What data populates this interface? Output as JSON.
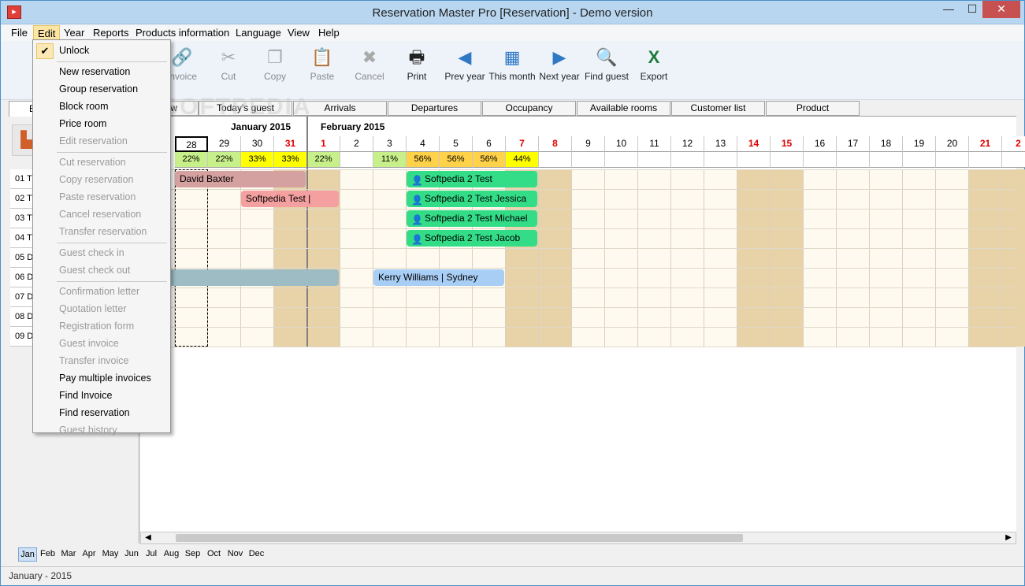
{
  "window": {
    "title": "Reservation Master Pro [Reservation] - Demo version",
    "minimize": "—",
    "maximize": "☐",
    "close": "✕"
  },
  "menubar": [
    "File",
    "Edit",
    "Year",
    "Reports",
    "Products information",
    "Language",
    "View",
    "Help"
  ],
  "toolbar": [
    {
      "label": "Invoice",
      "icon": "invoice-icon",
      "glyph": "🔗",
      "disabled": true
    },
    {
      "label": "Cut",
      "icon": "scissors-icon",
      "glyph": "✂",
      "disabled": true
    },
    {
      "label": "Copy",
      "icon": "copy-icon",
      "glyph": "❐",
      "disabled": true
    },
    {
      "label": "Paste",
      "icon": "paste-icon",
      "glyph": "📋",
      "disabled": true
    },
    {
      "label": "Cancel",
      "icon": "cancel-icon",
      "glyph": "✖",
      "disabled": true
    },
    {
      "label": "Print",
      "icon": "printer-icon",
      "glyph": "🖶",
      "disabled": false
    },
    {
      "label": "Prev year",
      "icon": "prev-year-icon",
      "glyph": "◀",
      "disabled": false
    },
    {
      "label": "This month",
      "icon": "this-month-icon",
      "glyph": "▦",
      "disabled": false
    },
    {
      "label": "Next year",
      "icon": "next-year-icon",
      "glyph": "▶",
      "disabled": false
    },
    {
      "label": "Find guest",
      "icon": "find-guest-icon",
      "glyph": "🔍",
      "disabled": false
    },
    {
      "label": "Export",
      "icon": "excel-export-icon",
      "glyph": "X",
      "disabled": false
    }
  ],
  "tabs": [
    "w",
    "Today's guest",
    "Arrivals",
    "Departures",
    "Occupancy",
    "Available rooms",
    "Customer list",
    "Product"
  ],
  "left_panel": {
    "tab": "B",
    "rooms": [
      "01 T",
      "02 T",
      "03 T",
      "04 T",
      "05 D",
      "06 D",
      "07 D",
      "08 D",
      "09 D"
    ]
  },
  "calendar": {
    "months": [
      "January 2015",
      "February 2015"
    ],
    "days": [
      {
        "d": "28",
        "occ": "22%",
        "red": false
      },
      {
        "d": "29",
        "occ": "22%",
        "red": false
      },
      {
        "d": "30",
        "occ": "33%",
        "red": false
      },
      {
        "d": "31",
        "occ": "33%",
        "red": true
      },
      {
        "d": "1",
        "occ": "22%",
        "red": true
      },
      {
        "d": "2",
        "occ": "",
        "red": false
      },
      {
        "d": "3",
        "occ": "11%",
        "red": false
      },
      {
        "d": "4",
        "occ": "56%",
        "red": false
      },
      {
        "d": "5",
        "occ": "56%",
        "red": false
      },
      {
        "d": "6",
        "occ": "56%",
        "red": false
      },
      {
        "d": "7",
        "occ": "44%",
        "red": true
      },
      {
        "d": "8",
        "occ": "",
        "red": true
      },
      {
        "d": "9",
        "occ": "",
        "red": false
      },
      {
        "d": "10",
        "occ": "",
        "red": false
      },
      {
        "d": "11",
        "occ": "",
        "red": false
      },
      {
        "d": "12",
        "occ": "",
        "red": false
      },
      {
        "d": "13",
        "occ": "",
        "red": false
      },
      {
        "d": "14",
        "occ": "",
        "red": true
      },
      {
        "d": "15",
        "occ": "",
        "red": true
      },
      {
        "d": "16",
        "occ": "",
        "red": false
      },
      {
        "d": "17",
        "occ": "",
        "red": false
      },
      {
        "d": "18",
        "occ": "",
        "red": false
      },
      {
        "d": "19",
        "occ": "",
        "red": false
      },
      {
        "d": "20",
        "occ": "",
        "red": false
      },
      {
        "d": "21",
        "occ": "",
        "red": true
      },
      {
        "d": "2",
        "occ": "",
        "red": true
      }
    ],
    "reservations": [
      {
        "label": "David Baxter",
        "row": 0,
        "start": 0,
        "span": 4,
        "color": "#d4a0a0",
        "icon": false
      },
      {
        "label": "Softpedia 2 Test",
        "row": 0,
        "start": 7,
        "span": 4,
        "color": "#33dd88",
        "icon": true
      },
      {
        "label": "Softpedia Test |",
        "row": 1,
        "start": 2,
        "span": 3,
        "color": "#f4a0a0",
        "icon": false
      },
      {
        "label": "Softpedia 2 Test Jessica",
        "row": 1,
        "start": 7,
        "span": 4,
        "color": "#33dd88",
        "icon": true
      },
      {
        "label": "Softpedia 2 Test Michael",
        "row": 2,
        "start": 7,
        "span": 4,
        "color": "#33dd88",
        "icon": true
      },
      {
        "label": "Softpedia 2 Test Jacob",
        "row": 3,
        "start": 7,
        "span": 4,
        "color": "#33dd88",
        "icon": true
      },
      {
        "label": "",
        "row": 5,
        "start": -1,
        "span": 6,
        "color": "#9dbcc4",
        "icon": false
      },
      {
        "label": "Kerry Williams | Sydney",
        "row": 5,
        "start": 6,
        "span": 4,
        "color": "#a8cef5",
        "icon": false
      }
    ]
  },
  "months_bar": [
    "Jan",
    "Feb",
    "Mar",
    "Apr",
    "May",
    "Jun",
    "Jul",
    "Aug",
    "Sep",
    "Oct",
    "Nov",
    "Dec"
  ],
  "status": "January - 2015",
  "edit_menu": [
    {
      "label": "Unlock",
      "disabled": false,
      "checked": true
    },
    {
      "sep": true
    },
    {
      "label": "New reservation",
      "disabled": false
    },
    {
      "label": "Group reservation",
      "disabled": false
    },
    {
      "label": "Block room",
      "disabled": false
    },
    {
      "label": "Price room",
      "disabled": false
    },
    {
      "label": "Edit reservation",
      "disabled": true
    },
    {
      "sep": true
    },
    {
      "label": "Cut reservation",
      "disabled": true
    },
    {
      "label": "Copy reservation",
      "disabled": true
    },
    {
      "label": "Paste reservation",
      "disabled": true
    },
    {
      "label": "Cancel reservation",
      "disabled": true
    },
    {
      "label": "Transfer reservation",
      "disabled": true
    },
    {
      "sep": true
    },
    {
      "label": "Guest check in",
      "disabled": true
    },
    {
      "label": "Guest check out",
      "disabled": true
    },
    {
      "sep": true
    },
    {
      "label": "Confirmation letter",
      "disabled": true
    },
    {
      "label": "Quotation letter",
      "disabled": true
    },
    {
      "label": "Registration form",
      "disabled": true
    },
    {
      "label": "Guest invoice",
      "disabled": true
    },
    {
      "label": "Transfer invoice",
      "disabled": true
    },
    {
      "label": "Pay multiple invoices",
      "disabled": false
    },
    {
      "label": "Find Invoice",
      "disabled": false
    },
    {
      "label": "Find reservation",
      "disabled": false
    },
    {
      "label": "Guest history",
      "disabled": true
    }
  ],
  "watermark": "SOFTPEDIA"
}
